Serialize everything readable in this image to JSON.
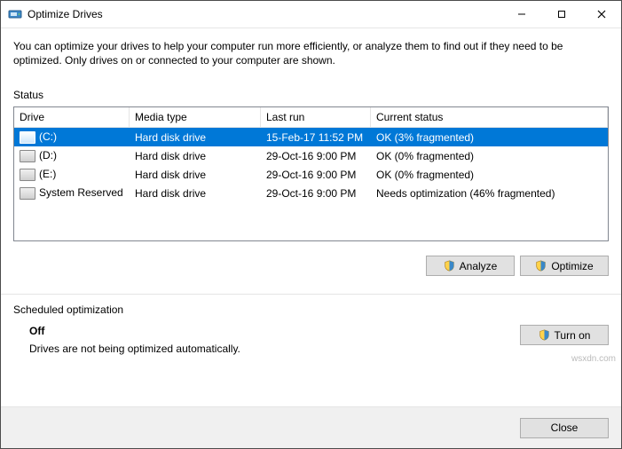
{
  "window": {
    "title": "Optimize Drives"
  },
  "intro": "You can optimize your drives to help your computer run more efficiently, or analyze them to find out if they need to be optimized. Only drives on or connected to your computer are shown.",
  "status": {
    "label": "Status",
    "columns": {
      "drive": "Drive",
      "media": "Media type",
      "last": "Last run",
      "status": "Current status"
    },
    "rows": [
      {
        "drive": "(C:)",
        "media": "Hard disk drive",
        "last": "15-Feb-17 11:52 PM",
        "status": "OK (3% fragmented)",
        "selected": true
      },
      {
        "drive": "(D:)",
        "media": "Hard disk drive",
        "last": "29-Oct-16 9:00 PM",
        "status": "OK (0% fragmented)",
        "selected": false
      },
      {
        "drive": "(E:)",
        "media": "Hard disk drive",
        "last": "29-Oct-16 9:00 PM",
        "status": "OK (0% fragmented)",
        "selected": false
      },
      {
        "drive": "System Reserved",
        "media": "Hard disk drive",
        "last": "29-Oct-16 9:00 PM",
        "status": "Needs optimization (46% fragmented)",
        "selected": false
      }
    ]
  },
  "buttons": {
    "analyze": "Analyze",
    "optimize": "Optimize",
    "turn_on": "Turn on",
    "close": "Close"
  },
  "schedule": {
    "label": "Scheduled optimization",
    "state": "Off",
    "desc": "Drives are not being optimized automatically."
  },
  "watermark": "wsxdn.com"
}
